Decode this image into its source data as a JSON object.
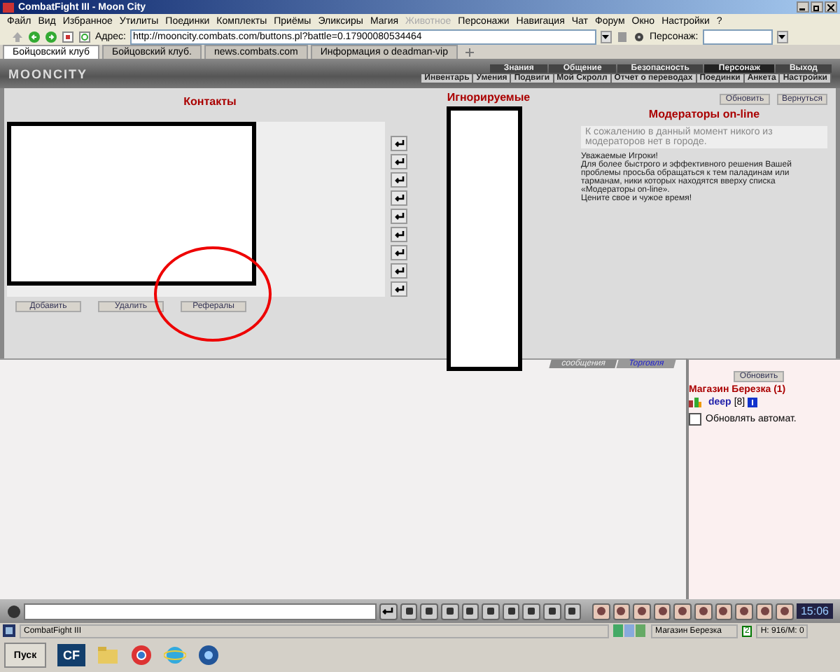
{
  "window": {
    "title": "CombatFight III - Moon City"
  },
  "menu": [
    {
      "label": "Файл",
      "disabled": false
    },
    {
      "label": "Вид",
      "disabled": false
    },
    {
      "label": "Избранное",
      "disabled": false
    },
    {
      "label": "Утилиты",
      "disabled": false
    },
    {
      "label": "Поединки",
      "disabled": false
    },
    {
      "label": "Комплекты",
      "disabled": false
    },
    {
      "label": "Приёмы",
      "disabled": false
    },
    {
      "label": "Эликсиры",
      "disabled": false
    },
    {
      "label": "Магия",
      "disabled": false
    },
    {
      "label": "Животное",
      "disabled": true
    },
    {
      "label": "Персонажи",
      "disabled": false
    },
    {
      "label": "Навигация",
      "disabled": false
    },
    {
      "label": "Чат",
      "disabled": false
    },
    {
      "label": "Форум",
      "disabled": false
    },
    {
      "label": "Окно",
      "disabled": false
    },
    {
      "label": "Настройки",
      "disabled": false
    },
    {
      "label": "?",
      "disabled": false
    }
  ],
  "address_bar": {
    "label": "Адрес:",
    "value": "http://mooncity.combats.com/buttons.pl?battle=0.17900080534464"
  },
  "character_field": {
    "label": "Персонаж:"
  },
  "browser_tabs": [
    {
      "label": "Бойцовский клуб",
      "selected": true
    },
    {
      "label": "Бойцовский клуб.",
      "selected": false
    },
    {
      "label": "news.combats.com",
      "selected": false
    },
    {
      "label": "Информация о deadman-vip",
      "selected": false
    }
  ],
  "game_nav": {
    "logo": "MOONCITY",
    "sections": [
      {
        "label": "Знания",
        "selected": false
      },
      {
        "label": "Общение",
        "selected": false
      },
      {
        "label": "Безопасность",
        "selected": false
      },
      {
        "label": "Персонаж",
        "selected": true
      },
      {
        "label": "Выход",
        "selected": false
      }
    ],
    "links": [
      "Инвентарь",
      "Умения",
      "Подвиги",
      "Мой Скролл",
      "Отчет о переводах",
      "Поединки",
      "Анкета",
      "Настройки"
    ]
  },
  "contacts": {
    "title": "Контакты",
    "buttons": [
      "Добавить",
      "Удалить",
      "Рефералы"
    ]
  },
  "ignored": {
    "title": "Игнорируемые"
  },
  "top_buttons": [
    "Обновить",
    "Вернуться"
  ],
  "moderators": {
    "title": "Модераторы on-line",
    "message": "К сожалению в данный момент никого из модераторов нет в городе.",
    "notice": [
      "Уважаемые Игроки!",
      "Для более быстрого и эффективного решения Вашей проблемы просьба обращаться к тем паладинам или тарманам, ники которых находятся вверху списка «Модераторы on-line».",
      "Цените свое и чужое время!"
    ]
  },
  "chat": {
    "tabs": [
      {
        "label": "сообщения",
        "selected": false
      },
      {
        "label": "Торговля",
        "selected": true
      }
    ]
  },
  "shop_panel": {
    "button": "Обновить",
    "title": "Магазин Березка (1)",
    "users": [
      {
        "name": "deep",
        "rank": "[8]"
      }
    ],
    "auto_refresh": {
      "label": "Обновлять автомат.",
      "checked": false
    }
  },
  "chat_bar": {
    "clock": "15:06"
  },
  "status_bar": {
    "app": "CombatFight III",
    "location": "Магазин Березка",
    "count": "2",
    "stats": "H: 916/M: 0"
  },
  "taskbar": {
    "start": "Пуск",
    "app_icon": "CF"
  }
}
